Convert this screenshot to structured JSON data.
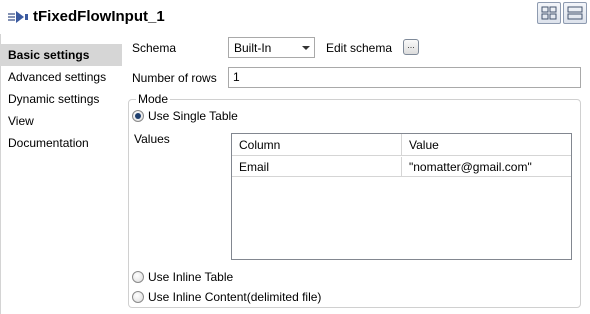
{
  "header": {
    "title": "tFixedFlowInput_1",
    "icon": "flow-input-icon"
  },
  "sidebar": {
    "items": [
      {
        "label": "Basic settings",
        "active": true
      },
      {
        "label": "Advanced settings",
        "active": false
      },
      {
        "label": "Dynamic settings",
        "active": false
      },
      {
        "label": "View",
        "active": false
      },
      {
        "label": "Documentation",
        "active": false
      }
    ]
  },
  "form": {
    "schema_label": "Schema",
    "schema_value": "Built-In",
    "edit_schema_label": "Edit schema",
    "edit_schema_button": "...",
    "rows_label": "Number of rows",
    "rows_value": "1",
    "mode_label": "Mode",
    "use_single_table": "Use Single Table",
    "values_label": "Values",
    "use_inline_table": "Use Inline Table",
    "use_inline_content": "Use Inline Content(delimited file)",
    "selected_mode": "Use Single Table"
  },
  "table": {
    "columns": [
      "Column",
      "Value"
    ],
    "rows": [
      [
        "Email",
        "\"nomatter@gmail.com\""
      ]
    ]
  },
  "colors": {
    "active_tab_bg": "#d6d6d6",
    "radio_checked": "#1f3f6e",
    "border": "#a9a9a9"
  }
}
